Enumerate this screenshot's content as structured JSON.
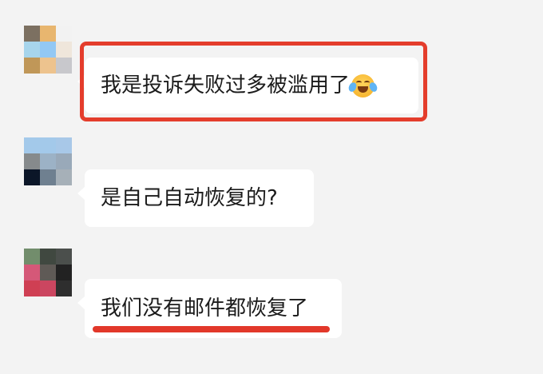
{
  "messages": [
    {
      "text": "我是投诉失败过多被滥用了",
      "emoji": "crying-laughing-emoji",
      "avatar_colors": [
        "#7c7061",
        "#e8b66f",
        "#f2f2f2",
        "#a7d5ec",
        "#93c8f4",
        "#efe6db",
        "#c09758",
        "#edc38e",
        "#c8c8cc"
      ]
    },
    {
      "text": "是自己自动恢复的?",
      "avatar_colors": [
        "#a3c9ea",
        "#a3c9ea",
        "#a8c8e8",
        "#868a8c",
        "#9cb2c6",
        "#99a9b9",
        "#0b1628",
        "#6f8090",
        "#a6b0b8"
      ]
    },
    {
      "text": "我们没有邮件都恢复了",
      "avatar_colors": [
        "#728d6c",
        "#404840",
        "#4b4f4c",
        "#d55878",
        "#5f5a56",
        "#222222",
        "#cf3f53",
        "#cb4660",
        "#2e2e2e"
      ]
    }
  ],
  "annotations": {
    "box_color": "#e43d2c",
    "underline_color": "#e2382a"
  }
}
